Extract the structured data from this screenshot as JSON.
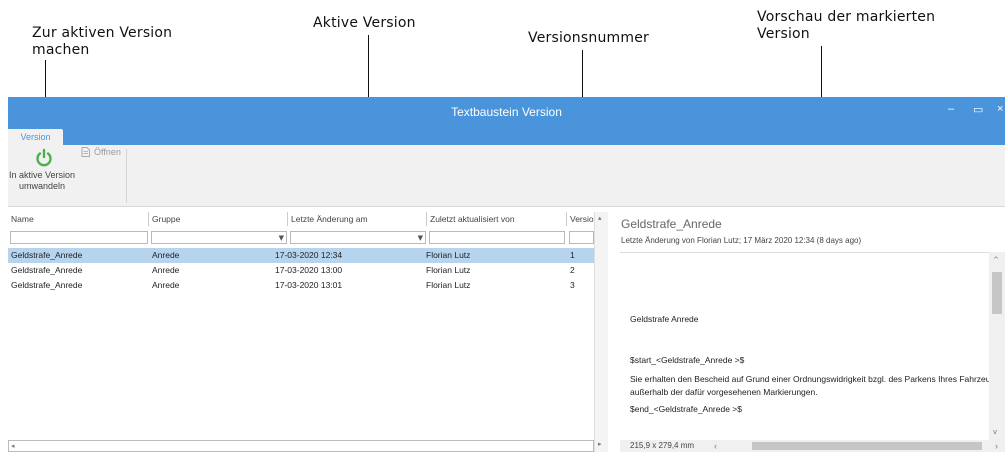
{
  "annotations": {
    "active_version_button": "Zur aktiven Version machen",
    "active_version": "Aktive Version",
    "version_number": "Versionsnummer",
    "preview": "Vorschau der markierten Version"
  },
  "window": {
    "title": "Textbaustein Version",
    "minimize": "–",
    "maximize": "▭",
    "close": "×"
  },
  "ribbon": {
    "tab": "Version",
    "make_active_label": "In aktive Version umwandeln",
    "open_label": "Öffnen"
  },
  "grid": {
    "columns": [
      "Name",
      "Gruppe",
      "Letzte Änderung am",
      "Zuletzt aktualisiert von",
      "Versio"
    ],
    "rows": [
      {
        "name": "Geldstrafe_Anrede",
        "group": "Anrede",
        "changed": "17-03-2020 12:34",
        "by": "Florian Lutz",
        "version": "1",
        "selected": true
      },
      {
        "name": "Geldstrafe_Anrede",
        "group": "Anrede",
        "changed": "17-03-2020 13:00",
        "by": "Florian Lutz",
        "version": "2",
        "selected": false
      },
      {
        "name": "Geldstrafe_Anrede",
        "group": "Anrede",
        "changed": "17-03-2020 13:01",
        "by": "Florian Lutz",
        "version": "3",
        "selected": false
      }
    ]
  },
  "preview": {
    "title": "Geldstrafe_Anrede",
    "meta": "Letzte Änderung von Florian Lutz; 17 März 2020 12:34 (8 days ago)",
    "heading": "Geldstrafe Anrede",
    "start_tag": "$start_<Geldstrafe_Anrede >$",
    "body_line1": "Sie erhalten den Bescheid auf Grund einer Ordnungswidrigkeit bzgl. des Parkens Ihres Fahrzeugs",
    "body_line2": "außerhalb der dafür vorgesehenen Markierungen.",
    "end_tag": "$end_<Geldstrafe_Anrede >$",
    "page_size": "215,9 x 279,4 mm"
  },
  "colors": {
    "accent": "#4a94db",
    "selection": "#b7d4ef",
    "power_icon": "#4caf50"
  }
}
